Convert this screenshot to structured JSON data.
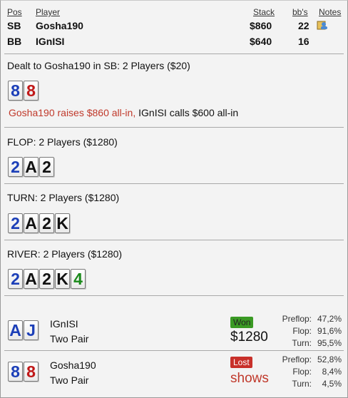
{
  "header": {
    "pos": "Pos",
    "player": "Player",
    "stack": "Stack",
    "bbs": "bb's",
    "notes": "Notes"
  },
  "players": [
    {
      "pos": "SB",
      "name": "Gosha190",
      "stack": "$860",
      "bbs": "22",
      "has_note_icon": true
    },
    {
      "pos": "BB",
      "name": "IGnISI",
      "stack": "$640",
      "bbs": "16",
      "has_note_icon": false
    }
  ],
  "preflop": {
    "title": "Dealt to Gosha190 in SB: 2 Players ($20)",
    "cards": [
      {
        "rank": "8",
        "color": "#1c3fb8"
      },
      {
        "rank": "8",
        "color": "#c01818"
      }
    ],
    "action_red": "Gosha190 raises $860 all-in,",
    "action_rest": " IGnISI calls $600 all-in"
  },
  "flop": {
    "title": "FLOP: 2 Players ($1280)",
    "cards": [
      {
        "rank": "2",
        "color": "#1c3fb8"
      },
      {
        "rank": "A",
        "color": "#111111"
      },
      {
        "rank": "2",
        "color": "#111111"
      }
    ]
  },
  "turn": {
    "title": "TURN: 2 Players ($1280)",
    "cards": [
      {
        "rank": "2",
        "color": "#1c3fb8"
      },
      {
        "rank": "A",
        "color": "#111111"
      },
      {
        "rank": "2",
        "color": "#111111"
      },
      {
        "rank": "K",
        "color": "#111111"
      }
    ]
  },
  "river": {
    "title": "RIVER: 2 Players ($1280)",
    "cards": [
      {
        "rank": "2",
        "color": "#1c3fb8"
      },
      {
        "rank": "A",
        "color": "#111111"
      },
      {
        "rank": "2",
        "color": "#111111"
      },
      {
        "rank": "K",
        "color": "#111111"
      },
      {
        "rank": "4",
        "color": "#1a8a1a"
      }
    ]
  },
  "results": [
    {
      "cards": [
        {
          "rank": "A",
          "color": "#1c3fb8"
        },
        {
          "rank": "J",
          "color": "#1c3fb8"
        }
      ],
      "name": "IGnISI",
      "hand": "Two Pair",
      "badge": "Won",
      "badge_color": "#3a9a24",
      "amount": "$1280",
      "amount_color": "#111111",
      "stats": [
        {
          "label": "Preflop:",
          "value": "47,2%"
        },
        {
          "label": "Flop:",
          "value": "91,6%"
        },
        {
          "label": "Turn:",
          "value": "95,5%"
        }
      ]
    },
    {
      "cards": [
        {
          "rank": "8",
          "color": "#1c3fb8"
        },
        {
          "rank": "8",
          "color": "#c01818"
        }
      ],
      "name": "Gosha190",
      "hand": "Two Pair",
      "badge": "Lost",
      "badge_color": "#c8302a",
      "amount": "shows",
      "amount_color": "#c0392b",
      "stats": [
        {
          "label": "Preflop:",
          "value": "52,8%"
        },
        {
          "label": "Flop:",
          "value": "8,4%"
        },
        {
          "label": "Turn:",
          "value": "4,5%"
        }
      ]
    }
  ]
}
